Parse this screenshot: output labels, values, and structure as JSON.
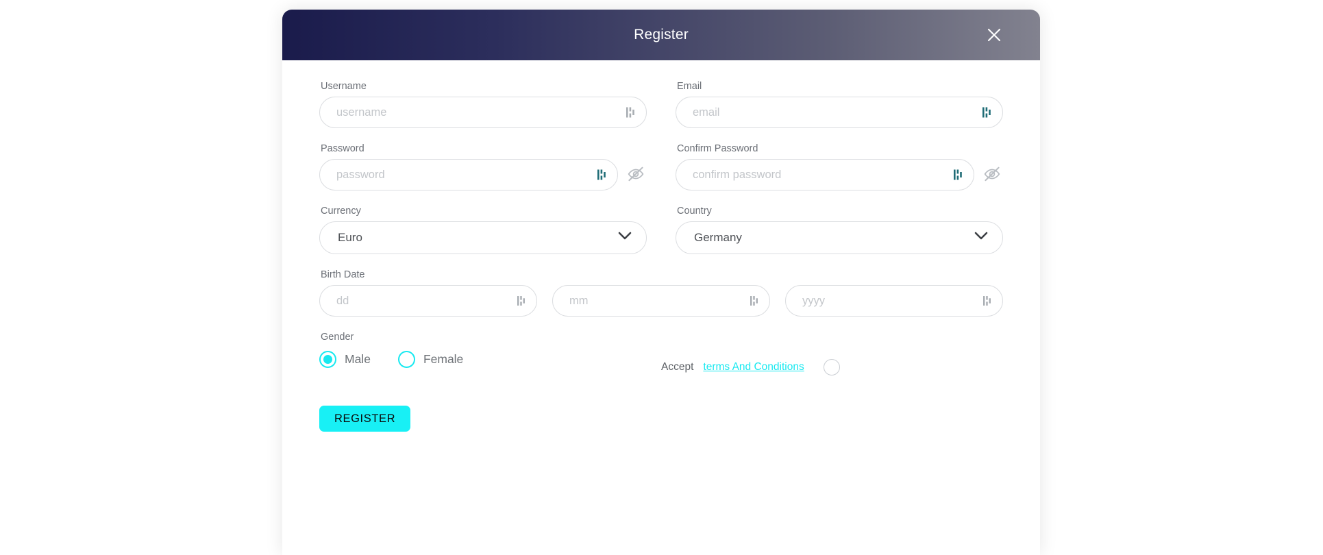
{
  "modal": {
    "title": "Register",
    "close_icon": "close-icon"
  },
  "form": {
    "username": {
      "label": "Username",
      "placeholder": "username",
      "value": "",
      "autofill_icon": "password-manager-icon",
      "autofill_tone": "grey"
    },
    "email": {
      "label": "Email",
      "placeholder": "email",
      "value": "",
      "autofill_icon": "password-manager-icon",
      "autofill_tone": "teal"
    },
    "password": {
      "label": "Password",
      "placeholder": "password",
      "value": "",
      "autofill_icon": "password-manager-icon",
      "autofill_tone": "teal",
      "toggle_icon": "eye-off-icon"
    },
    "confirm_password": {
      "label": "Confirm Password",
      "placeholder": "confirm password",
      "value": "",
      "autofill_icon": "password-manager-icon",
      "autofill_tone": "teal",
      "toggle_icon": "eye-off-icon"
    },
    "currency": {
      "label": "Currency",
      "selected": "Euro",
      "chevron_icon": "chevron-down-icon"
    },
    "country": {
      "label": "Country",
      "selected": "Germany",
      "chevron_icon": "chevron-down-icon"
    },
    "birth_date": {
      "label": "Birth Date",
      "day": {
        "placeholder": "dd",
        "value": ""
      },
      "month": {
        "placeholder": "mm",
        "value": ""
      },
      "year": {
        "placeholder": "yyyy",
        "value": ""
      }
    },
    "gender": {
      "label": "Gender",
      "options": [
        {
          "label": "Male",
          "selected": true
        },
        {
          "label": "Female",
          "selected": false
        }
      ]
    },
    "accept": {
      "prefix": "Accept",
      "link_text": "terms And Conditions",
      "checked": false
    },
    "submit": {
      "label": "REGISTER"
    }
  },
  "colors": {
    "accent": "#18f0f5",
    "link": "#18e9f0",
    "header_gradient_start": "#1a1b4b",
    "header_gradient_end": "#82828f",
    "label_text": "#6b6f76",
    "placeholder": "#c3c6ca",
    "border": "#dcdee1",
    "autofill_teal": "#1f6c76"
  }
}
